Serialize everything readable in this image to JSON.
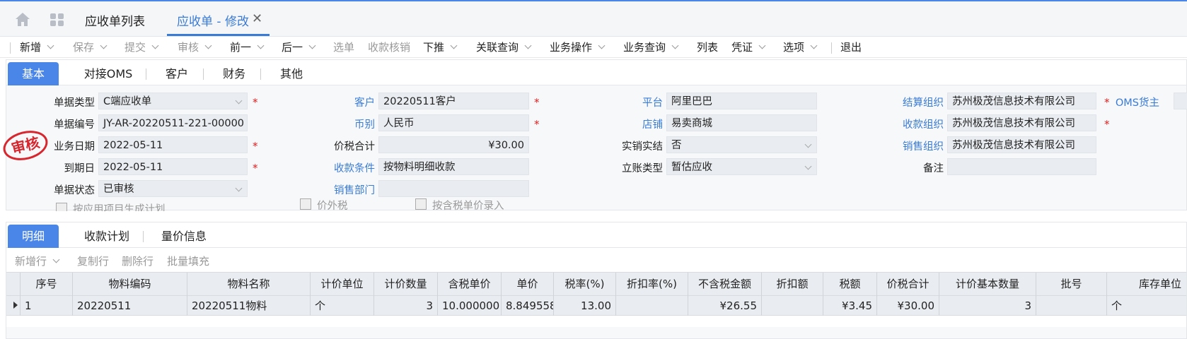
{
  "page_tabs": [
    {
      "label": "应收单列表"
    },
    {
      "label": "应收单 - 修改"
    }
  ],
  "toolbar": [
    {
      "label": "新增",
      "disabled": false,
      "caret": true
    },
    {
      "label": "保存",
      "disabled": true,
      "caret": true
    },
    {
      "label": "提交",
      "disabled": true,
      "caret": true
    },
    {
      "label": "审核",
      "disabled": true,
      "caret": true
    },
    {
      "label": "前一",
      "disabled": false,
      "caret": true
    },
    {
      "label": "后一",
      "disabled": false,
      "caret": true
    },
    {
      "label": "选单",
      "disabled": true,
      "caret": false
    },
    {
      "label": "收款核销",
      "disabled": true,
      "caret": false
    },
    {
      "label": "下推",
      "disabled": false,
      "caret": true
    },
    {
      "label": "关联查询",
      "disabled": false,
      "caret": true
    },
    {
      "label": "业务操作",
      "disabled": false,
      "caret": true
    },
    {
      "label": "业务查询",
      "disabled": false,
      "caret": true
    },
    {
      "label": "列表",
      "disabled": false,
      "caret": false
    },
    {
      "label": "凭证",
      "disabled": false,
      "caret": true
    },
    {
      "label": "选项",
      "disabled": false,
      "caret": true
    },
    {
      "label": "退出",
      "disabled": false,
      "caret": false
    }
  ],
  "header_tabs": [
    "基本",
    "对接OMS",
    "客户",
    "财务",
    "其他"
  ],
  "form": {
    "col1": [
      {
        "label": "单据类型",
        "value": "C端应收单",
        "select": true,
        "required": true
      },
      {
        "label": "单据编号",
        "value": "JY-AR-20220511-221-00000",
        "select": false,
        "required": false
      },
      {
        "label": "业务日期",
        "value": "2022-05-11",
        "select": false,
        "required": true
      },
      {
        "label": "到期日",
        "value": "2022-05-11",
        "select": false,
        "required": true
      },
      {
        "label": "单据状态",
        "value": "已审核",
        "select": true,
        "required": false
      }
    ],
    "col2": [
      {
        "label": "客户",
        "value": "20220511客户",
        "link": true,
        "required": true
      },
      {
        "label": "币别",
        "value": "人民币",
        "link": true,
        "required": true
      },
      {
        "label": "价税合计",
        "value": "¥30.00",
        "link": false,
        "required": false
      },
      {
        "label": "收款条件",
        "value": "按物料明细收款",
        "link": true,
        "required": false
      },
      {
        "label": "销售部门",
        "value": "",
        "link": true,
        "required": false
      }
    ],
    "col3": [
      {
        "label": "平台",
        "value": "阿里巴巴",
        "link": true,
        "select": false
      },
      {
        "label": "店铺",
        "value": "易卖商城",
        "link": true,
        "select": false
      },
      {
        "label": "实销实结",
        "value": "否",
        "link": false,
        "select": true
      },
      {
        "label": "立账类型",
        "value": "暂估应收",
        "link": false,
        "select": true
      }
    ],
    "col4": [
      {
        "label": "结算组织",
        "value": "苏州极茂信息技术有限公司",
        "link": true,
        "required": true
      },
      {
        "label": "收款组织",
        "value": "苏州极茂信息技术有限公司",
        "link": true,
        "required": true
      },
      {
        "label": "销售组织",
        "value": "苏州极茂信息技术有限公司",
        "link": true,
        "required": false
      },
      {
        "label": "备注",
        "value": "",
        "link": false,
        "required": false
      }
    ],
    "oms_owner_label": "OMS货主",
    "stamp_text": "审核",
    "checkboxes": [
      "按应用项目生成计划",
      "价外税",
      "按含税单价录入"
    ]
  },
  "detail_tabs": [
    "明细",
    "收款计划",
    "量价信息"
  ],
  "detail_toolbar": [
    {
      "label": "新增行",
      "caret": true
    },
    {
      "label": "复制行",
      "caret": false
    },
    {
      "label": "删除行",
      "caret": false
    },
    {
      "label": "批量填充",
      "caret": false
    }
  ],
  "grid": {
    "headers": [
      "序号",
      "物料编码",
      "物料名称",
      "计价单位",
      "计价数量",
      "含税单价",
      "单价",
      "税率(%)",
      "折扣率(%)",
      "不含税金额",
      "折扣额",
      "税额",
      "价税合计",
      "计价基本数量",
      "批号",
      "库存单位"
    ],
    "rows": [
      [
        "1",
        "20220511",
        "20220511物料",
        "个",
        "3",
        "10.000000",
        "8.849558",
        "13.00",
        "",
        "¥26.55",
        "",
        "¥3.45",
        "¥30.00",
        "3",
        "",
        "个"
      ]
    ]
  }
}
